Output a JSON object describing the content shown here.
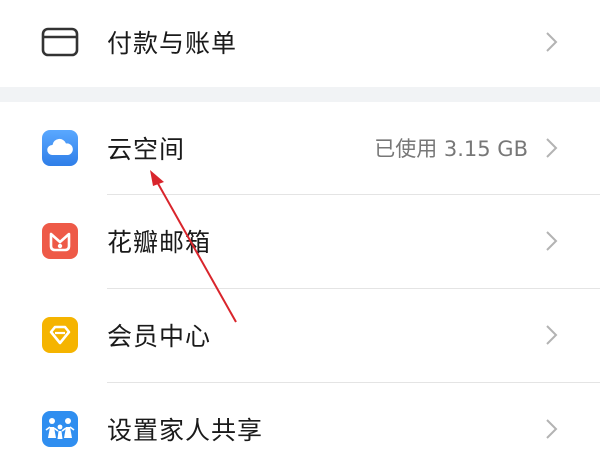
{
  "menu": {
    "payment": {
      "label": "付款与账单",
      "icon": "wallet-card-icon"
    },
    "cloud": {
      "label": "云空间",
      "value": "已使用 3.15 GB",
      "icon": "cloud-icon"
    },
    "mail": {
      "label": "花瓣邮箱",
      "icon": "petal-mail-icon"
    },
    "member": {
      "label": "会员中心",
      "icon": "diamond-icon"
    },
    "family": {
      "label": "设置家人共享",
      "icon": "family-icon"
    }
  },
  "colors": {
    "cloud": "#3a8ef6",
    "mail": "#ee5a48",
    "member": "#f5b400",
    "family": "#2f8ef0",
    "annotation": "#d9252c"
  }
}
